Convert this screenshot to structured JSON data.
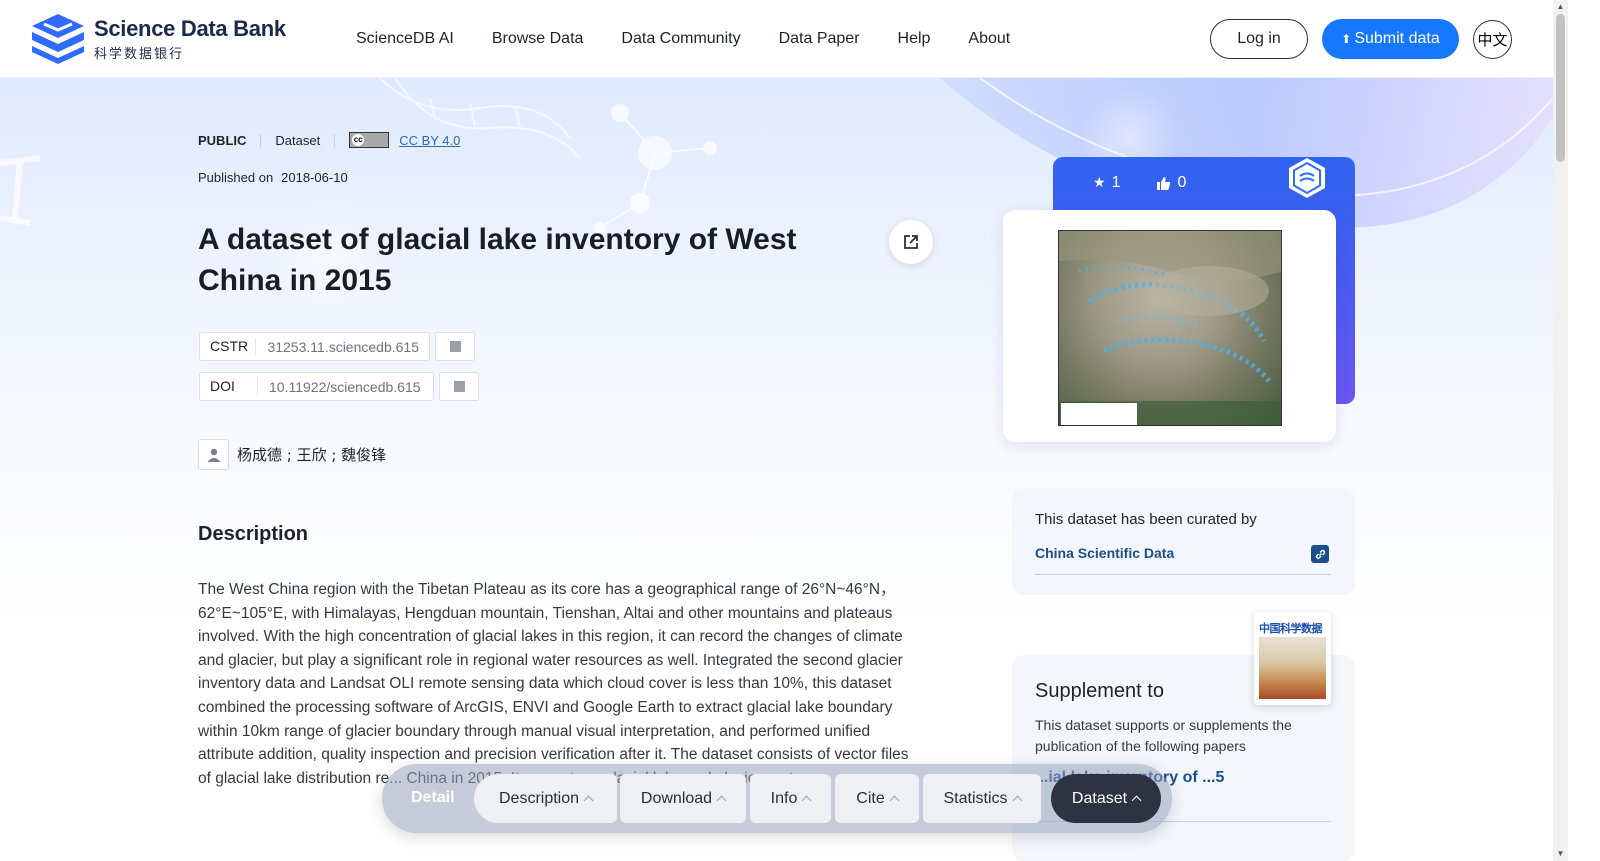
{
  "header": {
    "logo_en": "Science Data Bank",
    "logo_cn": "科学数据银行",
    "nav": [
      "ScienceDB AI",
      "Browse Data",
      "Data Community",
      "Data Paper",
      "Help",
      "About"
    ],
    "login": "Log in",
    "submit": "Submit data",
    "lang": "中文"
  },
  "meta": {
    "visibility": "PUBLIC",
    "type": "Dataset",
    "license": "CC BY 4.0",
    "published_label": "Published on",
    "published_date": "2018-06-10"
  },
  "title": "A dataset of glacial lake inventory of West China in 2015",
  "identifiers": {
    "cstr_label": "CSTR",
    "cstr_value": "31253.11.sciencedb.615",
    "doi_label": "DOI",
    "doi_value": "10.11922/sciencedb.615"
  },
  "authors": "杨成德 ; 王欣 ; 魏俊锋",
  "description": {
    "heading": "Description",
    "text": "The West China region with the Tibetan Plateau as its core has a geographical range of 26°N~46°N，62°E~105°E, with Himalayas, Hengduan mountain, Tienshan, Altai and other mountains and plateaus involved. With the high concentration of glacial lakes in this region, it can record the changes of climate and glacier, but play a significant role in regional water resources as well. Integrated the second glacier inventory data and Landsat OLI remote sensing data which cloud cover is less than 10%, this dataset combined the processing software of ArcGIS, ENVI and Google Earth to extract glacial lake boundary within 10km range of glacier boundary through manual visual interpretation, and performed unified attribute addition, quality inspection and precision verification after it. The dataset consists of vector files of glacial lake distribution re... China in 2015. It can not o... glacial lake and glacier, wate..."
  },
  "stats": {
    "stars": "1",
    "likes": "0"
  },
  "curated": {
    "text": "This dataset has been curated by",
    "link": "China Scientific Data"
  },
  "supplement": {
    "heading": "Supplement to",
    "text": "This dataset supports or supplements the publication of the following papers",
    "paper": "...ial lake inventory of ...5",
    "journal_title": "中国科学数据"
  },
  "tabbar": {
    "detail": "Detail",
    "tabs": [
      "Description",
      "Download",
      "Info",
      "Cite",
      "Statistics",
      "Dataset"
    ],
    "active": "Dataset"
  },
  "colors": {
    "primary": "#1677ff",
    "link": "#1b4f8c",
    "card_gradient_start": "#2f63f0",
    "card_gradient_end": "#6b56f2",
    "active_tab": "#2d3340"
  }
}
